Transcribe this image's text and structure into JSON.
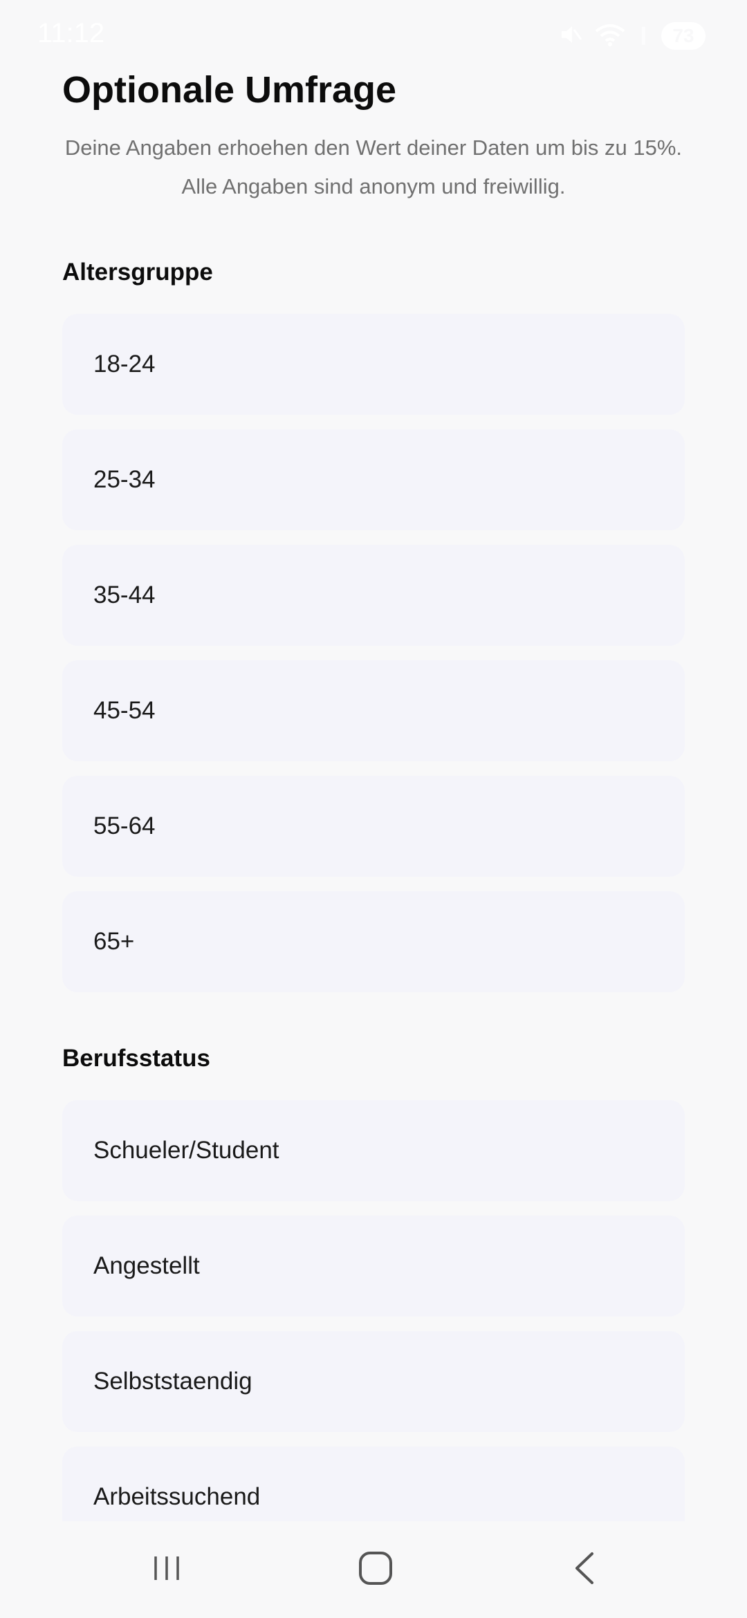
{
  "status_bar": {
    "time": "11:12",
    "battery": "73",
    "icons": [
      "mute-icon",
      "wifi-icon",
      "signal-icon",
      "battery-icon"
    ]
  },
  "header": {
    "title": "Optionale Umfrage",
    "subtitle": "Deine Angaben erhoehen den Wert deiner Daten um bis zu 15%. Alle Angaben sind anonym und freiwillig."
  },
  "age_section": {
    "title": "Altersgruppe",
    "options": [
      "18-24",
      "25-34",
      "35-44",
      "45-54",
      "55-64",
      "65+"
    ]
  },
  "job_section": {
    "title": "Berufsstatus",
    "options": [
      "Schueler/Student",
      "Angestellt",
      "Selbststaendig",
      "Arbeitssuchend"
    ]
  },
  "nav_bar": {
    "icons": [
      "recent-apps-icon",
      "home-icon",
      "back-icon"
    ]
  },
  "colors": {
    "background": "#f8f8f9",
    "option_background": "#f4f4fa",
    "title_text": "#0c0c0c",
    "muted_text": "#707070"
  }
}
